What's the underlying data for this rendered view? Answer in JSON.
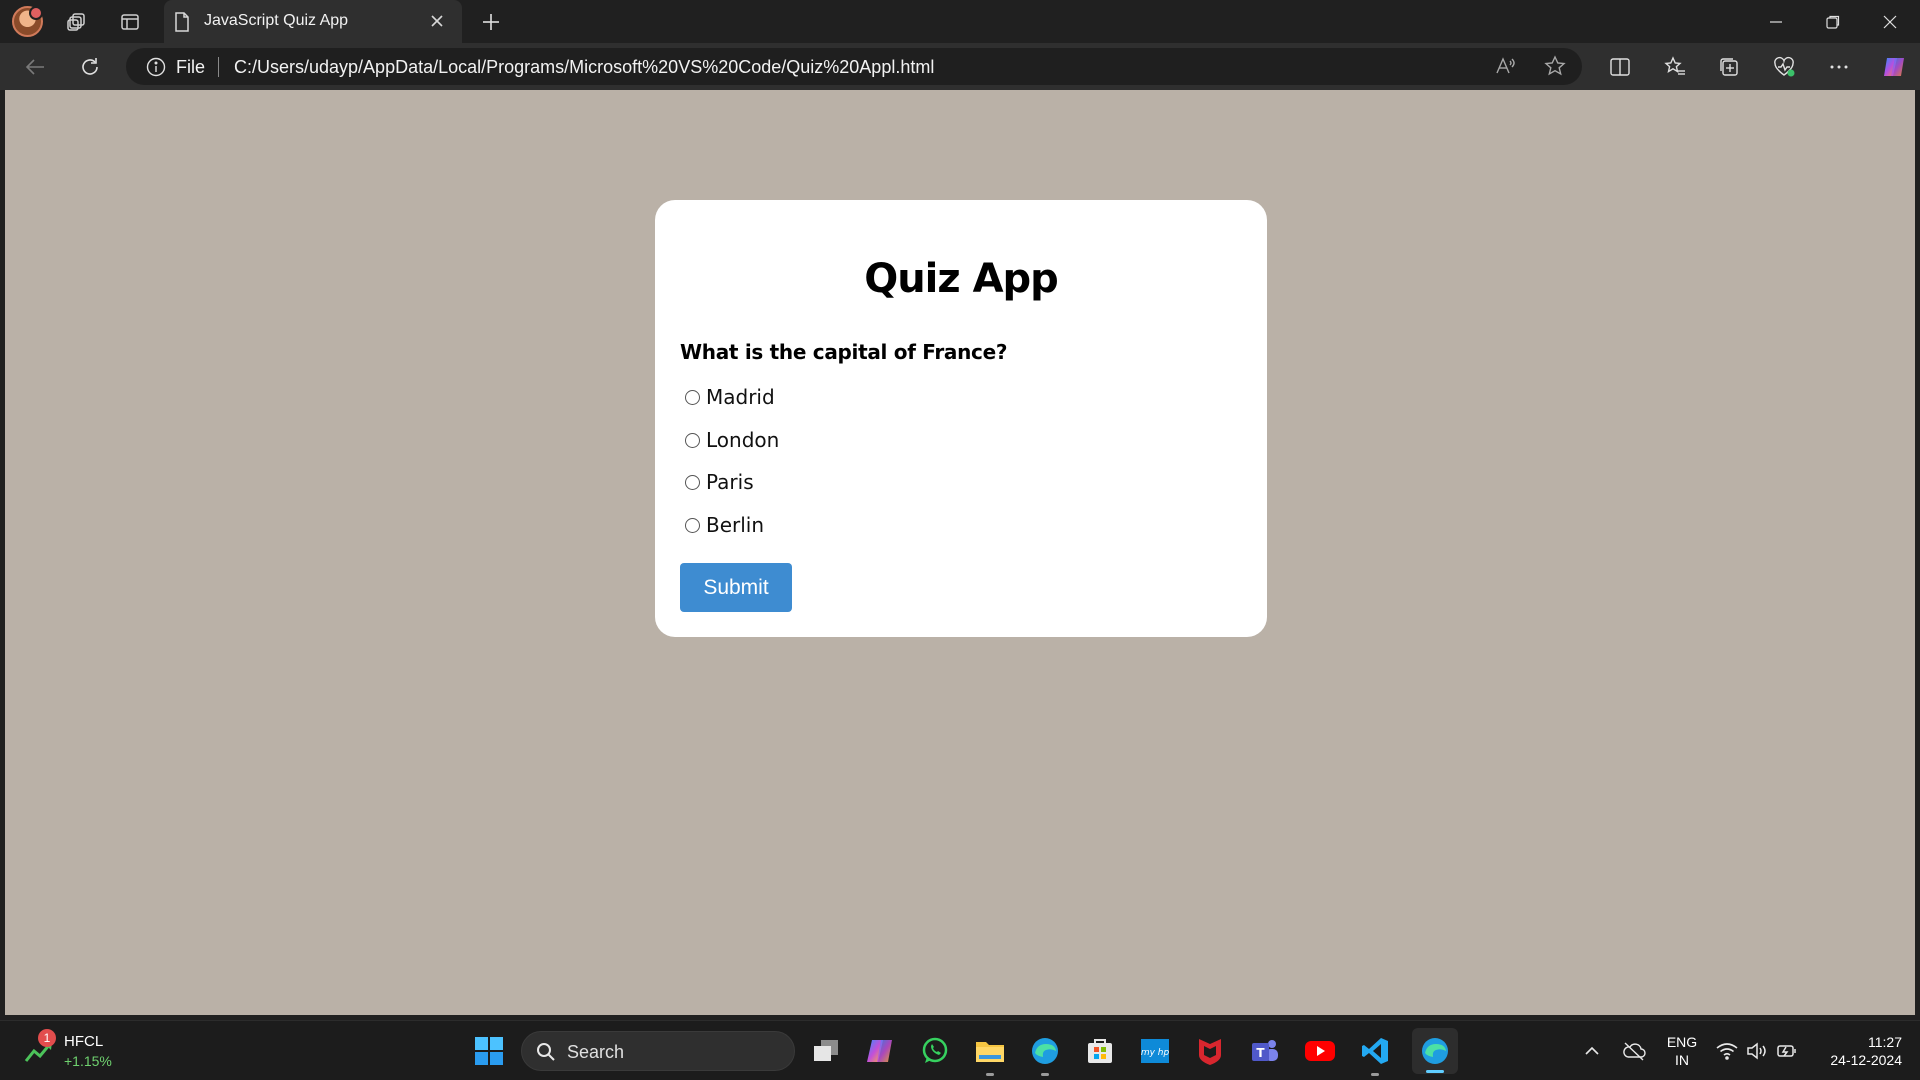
{
  "browser": {
    "tab_title": "JavaScript Quiz App",
    "address_scheme_label": "File",
    "url": "C:/Users/udayp/AppData/Local/Programs/Microsoft%20VS%20Code/Quiz%20Appl.html"
  },
  "page": {
    "title": "Quiz App",
    "question": "What is the capital of France?",
    "options": [
      "Madrid",
      "London",
      "Paris",
      "Berlin"
    ],
    "selected_option": null,
    "submit_label": "Submit",
    "colors": {
      "background": "#bab1a7",
      "card": "#ffffff",
      "submit": "#3e8cd1"
    }
  },
  "taskbar": {
    "stock_symbol": "HFCL",
    "stock_change": "+1.15%",
    "stock_notification_count": "1",
    "search_label": "Search",
    "language_line1": "ENG",
    "language_line2": "IN",
    "time": "11:27",
    "date": "24-12-2024",
    "pinned_apps": [
      "task-view",
      "copilot",
      "whatsapp",
      "file-explorer",
      "edge",
      "microsoft-store",
      "myhp",
      "mcafee",
      "teams",
      "youtube",
      "vs-code",
      "edge-active"
    ]
  }
}
